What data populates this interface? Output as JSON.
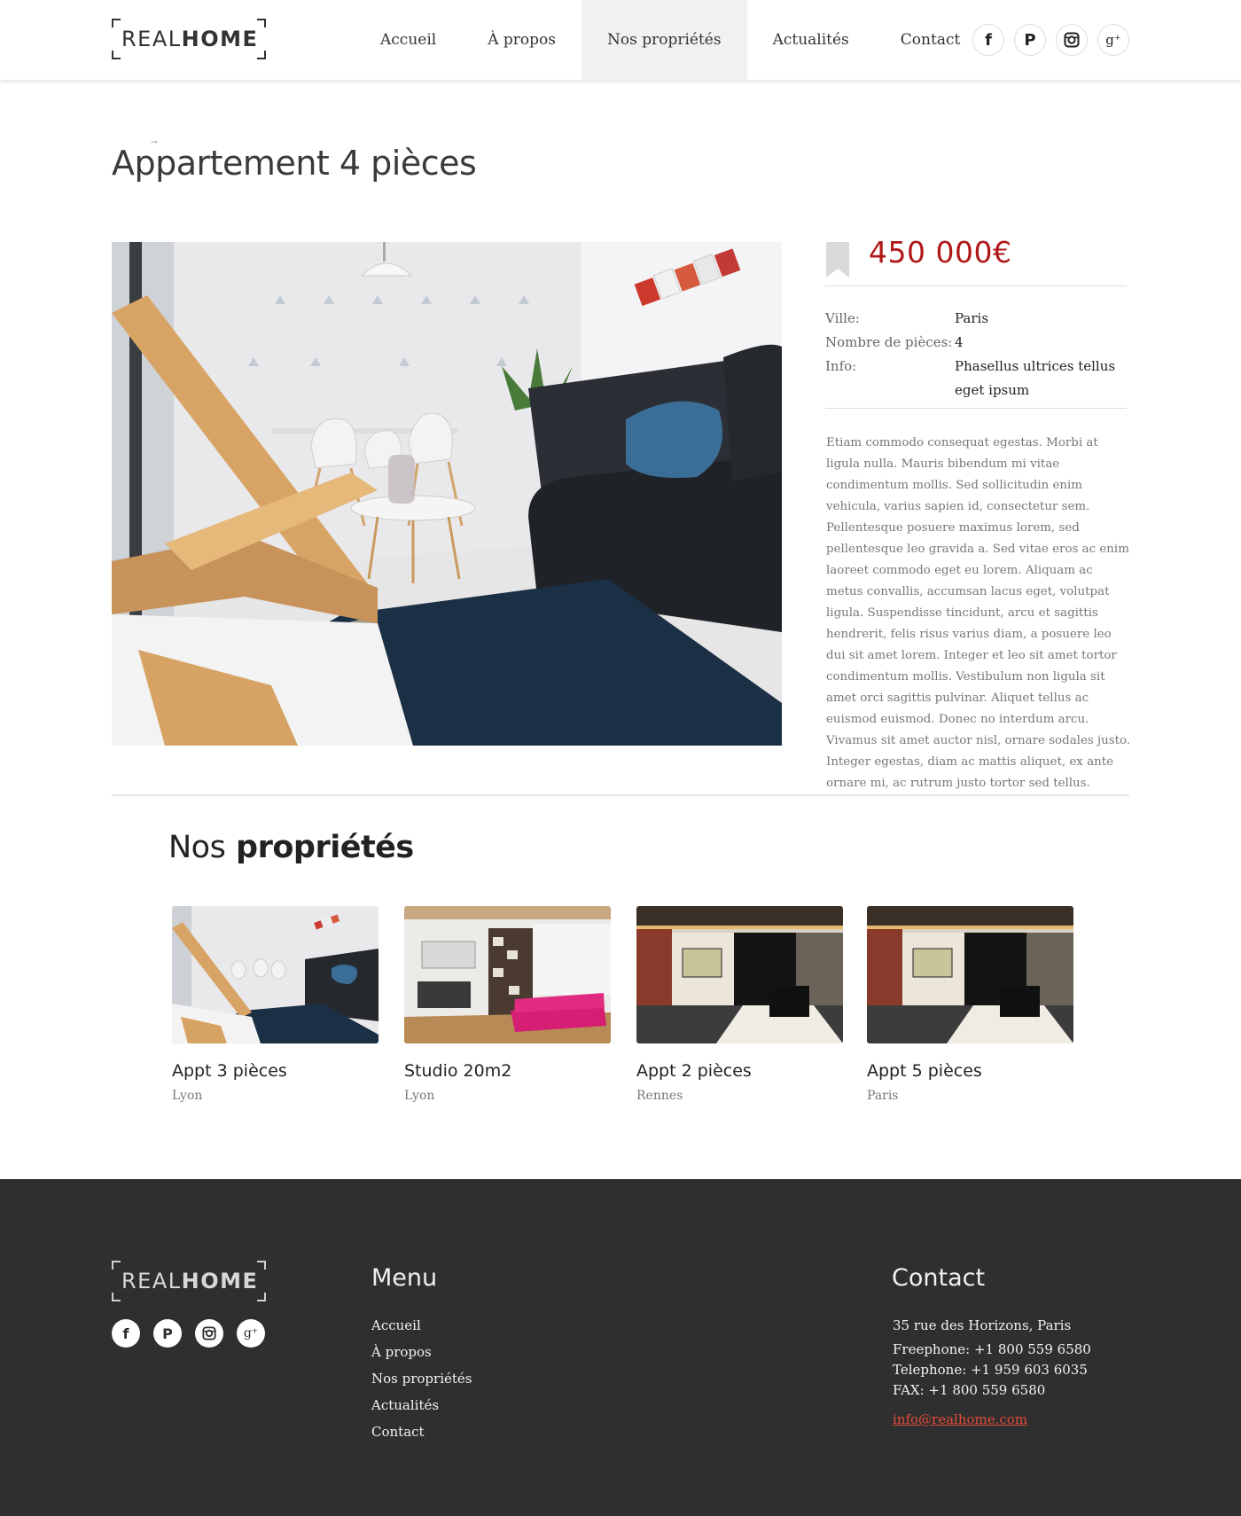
{
  "colors": {
    "accent": "#b01818",
    "footer_bg": "#2f2f2f",
    "link_red": "#e24b3b",
    "nav_active_bg": "#f1f1f1"
  },
  "brand": {
    "logo_light": "REAL",
    "logo_bold": "HOME"
  },
  "nav": {
    "items": [
      {
        "label": "Accueil"
      },
      {
        "label": "À propos"
      },
      {
        "label": "Nos propriétés",
        "active": true
      },
      {
        "label": "Actualités"
      },
      {
        "label": "Contact"
      }
    ]
  },
  "social": {
    "icons": [
      "facebook-icon",
      "pinterest-icon",
      "instagram-icon",
      "google-plus-icon"
    ],
    "glyphs": [
      "f",
      "P",
      "◎",
      "g⁺"
    ]
  },
  "listing": {
    "title": "Appartement 4 pièces",
    "price": "450 000€",
    "details": [
      {
        "label": "Ville:",
        "value": "Paris"
      },
      {
        "label": "Nombre de pièces:",
        "value": "4"
      },
      {
        "label": "Info:",
        "value": "Phasellus ultrices tellus eget ipsum"
      }
    ],
    "description": "Etiam commodo consequat egestas. Morbi at ligula nulla. Mauris bibendum mi vitae condimentum mollis. Sed sollicitudin enim vehicula, varius sapien id, consectetur sem. Pellentesque posuere maximus lorem, sed pellentesque leo gravida a. Sed vitae eros ac enim laoreet commodo eget eu lorem. Aliquam ac metus convallis, accumsan lacus eget, volutpat ligula. Suspendisse tincidunt, arcu et sagittis hendrerit, felis risus varius diam, a posuere leo dui sit amet lorem. Integer et leo sit amet tortor condimentum mollis. Vestibulum non ligula sit amet orci sagittis pulvinar. Aliquet tellus ac euismod euismod. Donec no interdum arcu. Vivamus sit amet auctor nisl, ornare sodales justo. Integer egestas, diam ac mattis aliquet, ex ante ornare mi, ac rutrum justo tortor sed tellus."
  },
  "properties": {
    "heading_light": "Nos",
    "heading_bold": "propriétés",
    "cards": [
      {
        "name": "Appt 3 pièces",
        "city": "Lyon"
      },
      {
        "name": "Studio 20m2",
        "city": "Lyon"
      },
      {
        "name": "Appt 2 pièces",
        "city": "Rennes"
      },
      {
        "name": "Appt 5 pièces",
        "city": "Paris"
      }
    ]
  },
  "footer": {
    "menu_title": "Menu",
    "menu_items": [
      "Accueil",
      "À propos",
      "Nos propriétés",
      "Actualités",
      "Contact"
    ],
    "contact_title": "Contact",
    "address": "35 rue des Horizons, Paris",
    "freephone": "Freephone: +1 800 559 6580",
    "telephone": "Telephone: +1 959 603 6035",
    "fax": "FAX: +1 800 559 6580",
    "email": "info@realhome.com"
  }
}
